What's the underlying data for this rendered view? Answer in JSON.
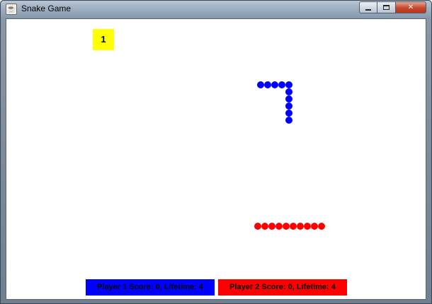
{
  "window": {
    "title": "Snake Game",
    "app_icon": "java-cup-icon",
    "controls": [
      "minimize-icon",
      "maximize-icon",
      "close-icon"
    ]
  },
  "game": {
    "food": {
      "label": "1",
      "color": "#ffff00"
    },
    "snakes": [
      {
        "player": 1,
        "color": "#0000ff",
        "segments": 10
      },
      {
        "player": 2,
        "color": "#ff0000",
        "segments": 10
      }
    ]
  },
  "scoreboard": {
    "player1": {
      "text": "Player 1 Score: 0, Lifetime: 4",
      "color": "#0000ff"
    },
    "player2": {
      "text": "Player 2 Score: 0, Lifetime: 4",
      "color": "#ff0000"
    }
  }
}
